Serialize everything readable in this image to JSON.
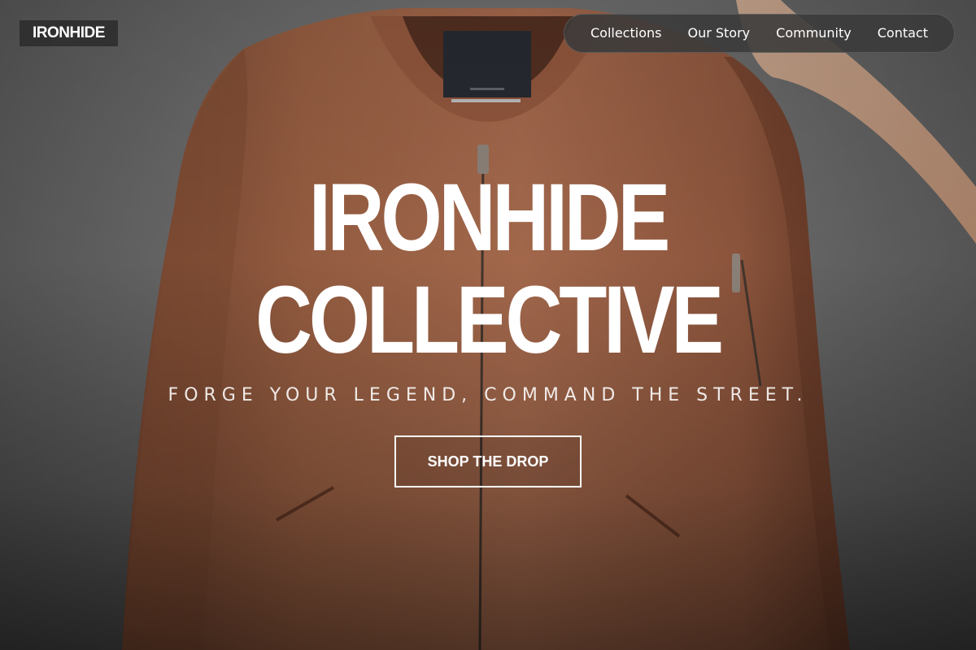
{
  "brand": {
    "logo_text": "IRONHIDE"
  },
  "nav": {
    "items": [
      {
        "label": "Collections"
      },
      {
        "label": "Our Story"
      },
      {
        "label": "Community"
      },
      {
        "label": "Contact"
      }
    ]
  },
  "hero": {
    "title_line1": "IRONHIDE",
    "title_line2": "COLLECTIVE",
    "tagline": "FORGE YOUR LEGEND, COMMAND THE STREET.",
    "cta_label": "SHOP THE DROP",
    "image_subject": "rust-brown bomber jacket on hanger"
  },
  "colors": {
    "jacket": "#a8674a",
    "background_gray": "#707070",
    "text": "#ffffff"
  }
}
